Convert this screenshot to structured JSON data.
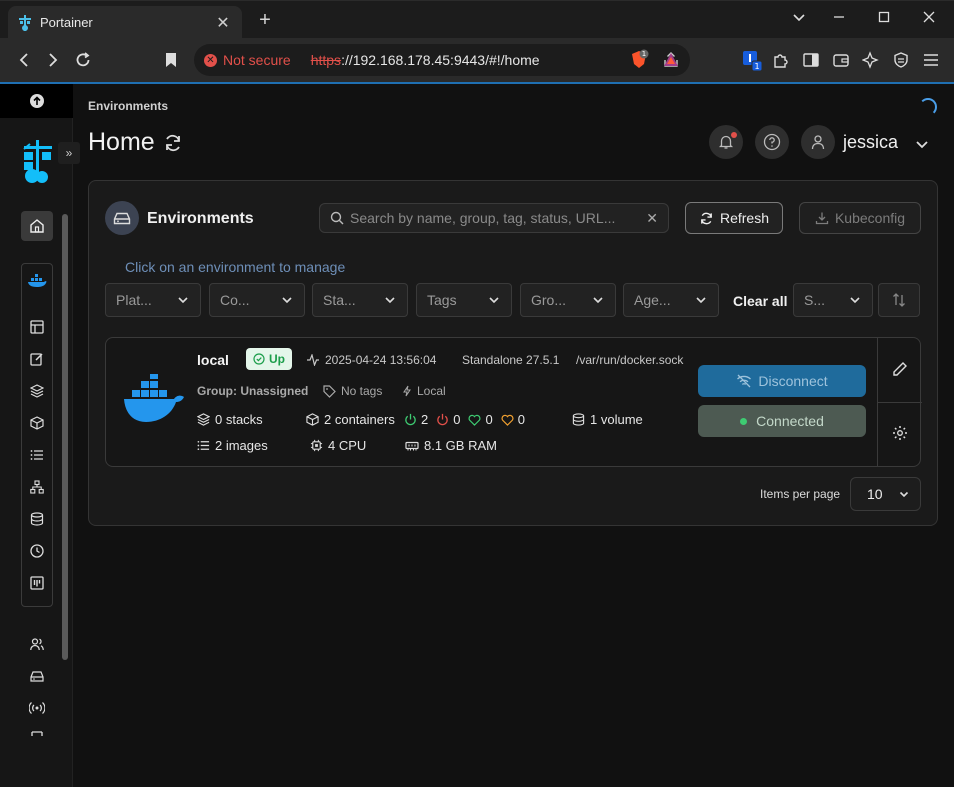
{
  "browser": {
    "tab_title": "Portainer",
    "new_tab": "+",
    "security_label": "Not secure",
    "url_scheme": "https",
    "url_rest": "://192.168.178.45:9443/#!/home",
    "brave_badge": "1",
    "ext_badge": "1"
  },
  "header": {
    "breadcrumb": "Environments",
    "title": "Home",
    "username": "jessica"
  },
  "card": {
    "title": "Environments",
    "search_placeholder": "Search by name, group, tag, status, URL...",
    "refresh_label": "Refresh",
    "kubeconfig_label": "Kubeconfig",
    "hint": "Click on an environment to manage",
    "filters": [
      "Plat...",
      "Co...",
      "Sta...",
      "Tags",
      "Gro...",
      "Age..."
    ],
    "clear_all": "Clear all",
    "sort_label": "S...",
    "items_per_page_label": "Items per page",
    "items_per_page_value": "10"
  },
  "environment": {
    "name": "local",
    "status": "Up",
    "timestamp": "2025-04-24 13:56:04",
    "type": "Standalone 27.5.1",
    "socket": "/var/run/docker.sock",
    "group": "Group: Unassigned",
    "tags": "No tags",
    "locality": "Local",
    "stacks": "0 stacks",
    "containers": "2 containers",
    "running": "2",
    "stopped": "0",
    "healthy": "0",
    "unhealthy": "0",
    "volumes": "1 volume",
    "images": "2 images",
    "cpu": "4 CPU",
    "ram": "8.1 GB RAM",
    "disconnect_label": "Disconnect",
    "connected_label": "Connected"
  },
  "colors": {
    "accent": "#1f6fb2",
    "up_green": "#1b9d4a",
    "docker_blue": "#2496ed",
    "not_secure_red": "#e2504a"
  }
}
